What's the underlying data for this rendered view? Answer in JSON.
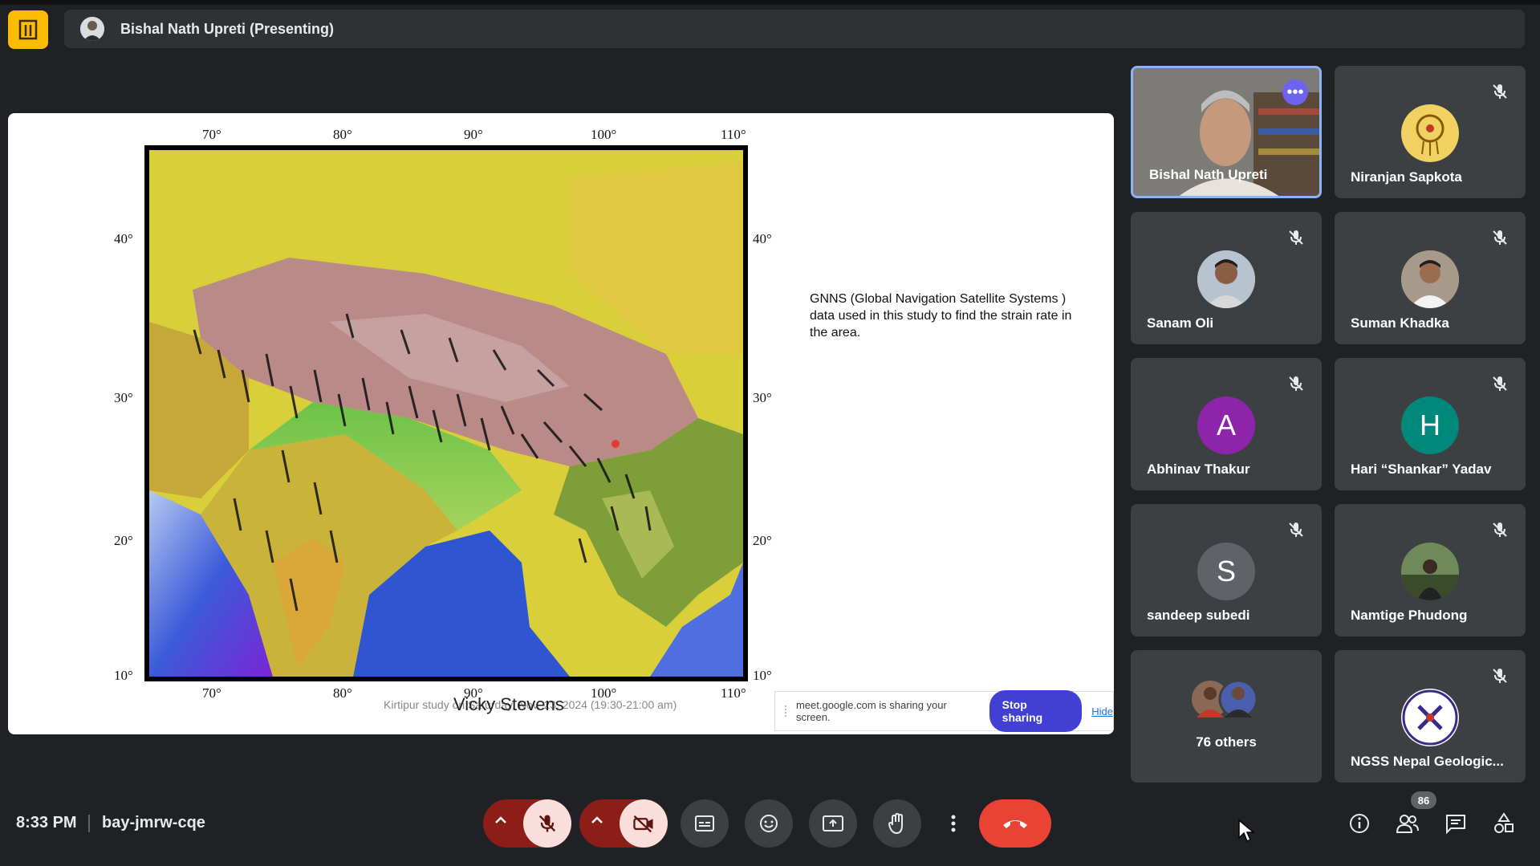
{
  "header": {
    "presenter_label": "Bishal Nath Upreti (Presenting)"
  },
  "slide": {
    "body_text": "GNNS (Global Navigation Satellite Systems ) data used in this study to find the strain rate in the area.",
    "footer_text": "Kirtipur study on Saturday, Nov. 23, 2024 (19:30-21:00 am)",
    "caption_overlay": "Vicky Stevens",
    "map": {
      "top_lon_labels": [
        "70°",
        "80°",
        "90°",
        "100°",
        "110°"
      ],
      "bottom_lon_labels": [
        "70°",
        "80°",
        "90°",
        "100°",
        "110°"
      ],
      "left_lat_labels": [
        "40°",
        "30°",
        "20°",
        "10°"
      ],
      "right_lat_labels": [
        "40°",
        "30°",
        "20°",
        "10°"
      ]
    }
  },
  "share_bar": {
    "message": "meet.google.com is sharing your screen.",
    "stop_label": "Stop sharing",
    "hide_label": "Hide"
  },
  "participants": [
    {
      "name": "Bishal Nath Upreti",
      "muted": false,
      "avatar": "video"
    },
    {
      "name": "Niranjan Sapkota",
      "muted": true,
      "avatar": "image"
    },
    {
      "name": "Sanam Oli",
      "muted": true,
      "avatar": "image"
    },
    {
      "name": "Suman Khadka",
      "muted": true,
      "avatar": "image"
    },
    {
      "name": "Abhinav Thakur",
      "muted": true,
      "avatar": "A",
      "color": "#8e24aa"
    },
    {
      "name": "Hari “Shankar” Yadav",
      "muted": true,
      "avatar": "H",
      "color": "#00897b"
    },
    {
      "name": "sandeep subedi",
      "muted": true,
      "avatar": "S",
      "color": "#5f6368"
    },
    {
      "name": "Namtige Phudong",
      "muted": true,
      "avatar": "image"
    },
    {
      "name": "76 others",
      "muted": false,
      "avatar": "group"
    },
    {
      "name": "NGSS Nepal Geologic...",
      "muted": true,
      "avatar": "logo"
    }
  ],
  "footer": {
    "time": "8:33 PM",
    "meeting_code": "bay-jmrw-cqe",
    "people_count": "86"
  },
  "colors": {
    "accent": "#8ab4f8",
    "end_call": "#ea4335",
    "mic_off_bg": "#f9dedc",
    "logo": "#fbbc04"
  }
}
